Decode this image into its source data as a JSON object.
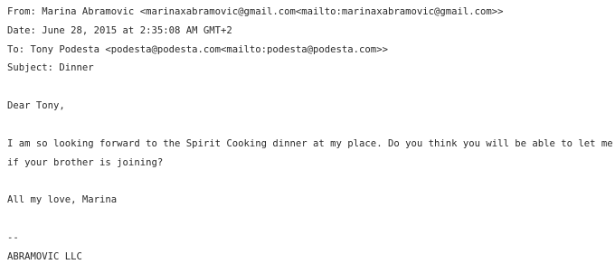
{
  "header": {
    "from": "From: Marina Abramovic <marinaxabramovic@gmail.com<mailto:marinaxabramovic@gmail.com>>",
    "date": "Date: June 28, 2015 at 2:35:08 AM GMT+2",
    "to": "To: Tony Podesta <podesta@podesta.com<mailto:podesta@podesta.com>>",
    "subject": "Subject: Dinner"
  },
  "body": {
    "greeting": "Dear Tony,",
    "paragraph_line1": "I am so looking forward to the Spirit Cooking dinner at my place. Do you think you will be able to let me know",
    "paragraph_line2": "if your brother is joining?",
    "closing": "All my love, Marina",
    "sig_separator": "--",
    "signature": "ABRAMOVIC LLC"
  }
}
